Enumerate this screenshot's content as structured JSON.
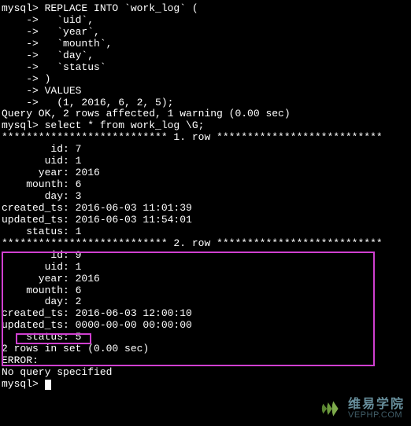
{
  "terminal": {
    "lines": [
      "mysql> REPLACE INTO `work_log` (",
      "    ->   `uid`,",
      "    ->   `year`,",
      "    ->   `mounth`,",
      "    ->   `day`,",
      "    ->   `status`",
      "    -> )",
      "    -> VALUES",
      "    ->   (1, 2016, 6, 2, 5);",
      "Query OK, 2 rows affected, 1 warning (0.00 sec)",
      "",
      "mysql> select * from work_log \\G;",
      "*************************** 1. row ***************************",
      "        id: 7",
      "       uid: 1",
      "      year: 2016",
      "    mounth: 6",
      "       day: 3",
      "created_ts: 2016-06-03 11:01:39",
      "updated_ts: 2016-06-03 11:54:01",
      "    status: 1",
      "*************************** 2. row ***************************",
      "        id: 9",
      "       uid: 1",
      "      year: 2016",
      "    mounth: 6",
      "       day: 2",
      "created_ts: 2016-06-03 12:00:10",
      "updated_ts: 0000-00-00 00:00:00",
      "    status: 5",
      "2 rows in set (0.00 sec)",
      "",
      "ERROR:",
      "No query specified",
      "",
      "mysql> "
    ]
  },
  "watermark": {
    "cn": "维易学院",
    "url": "VEPHP.COM"
  },
  "query_result": {
    "rows_affected": 2,
    "warnings": 1,
    "exec_time_sec": 0.0,
    "rows_in_set": 2
  },
  "rows": [
    {
      "id": 7,
      "uid": 1,
      "year": 2016,
      "mounth": 6,
      "day": 3,
      "created_ts": "2016-06-03 11:01:39",
      "updated_ts": "2016-06-03 11:54:01",
      "status": 1
    },
    {
      "id": 9,
      "uid": 1,
      "year": 2016,
      "mounth": 6,
      "day": 2,
      "created_ts": "2016-06-03 12:00:10",
      "updated_ts": "0000-00-00 00:00:00",
      "status": 5
    }
  ]
}
